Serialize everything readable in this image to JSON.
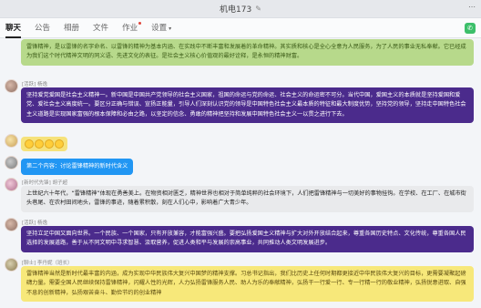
{
  "window": {
    "title": "机电173",
    "edit_icon": "edit-icon"
  },
  "tabs": [
    {
      "label": "聊天",
      "active": true
    },
    {
      "label": "公告"
    },
    {
      "label": "相册"
    },
    {
      "label": "文件"
    },
    {
      "label": "作业",
      "dot": true
    },
    {
      "label": "设置"
    }
  ],
  "messages": [
    {
      "sender": "",
      "text": "雷锋精神，是以雷锋的名字命名、以雷锋的精神为基本内涵、在实践中不断丰富和发展着的革命精神。其实质和核心是全心全意为人民服务，为了人民的事业无私奉献。它已经成为我们这个时代精神文明的同义语、先进文化的表征。是社会主义核心价值观的最好诠释，是永恒的精神财富。",
      "style": "green"
    },
    {
      "sender": "[活跃] 杨逸",
      "text": "坚持爱党爱国是社会主义精神一。新中国是中国共产党领导的社会主义国家，祖国的命运与党的命运、社会主义的命运密不可分。当代中国，爱国主义的本质就是坚持爱国和爱党、爱社会主义高度统一。要区分正确与错误、宣扬正能量，引导人们深刻认识党的领导是中国特色社会主义最本质的特征和最大制度优势，坚持党的领导，坚持走中国特色社会主义道路是实现国家富强的根本保障和必由之路，以坚定的信念、勇敢的精神把坚持和发展中国特色社会主义一以贯之进行下去。",
      "style": "purple"
    },
    {
      "sender": "",
      "emoji_count": 4,
      "style": "yellow"
    },
    {
      "sender": "",
      "text": "第二个内容：讨论雷锋精神的新时代含义",
      "style": "blue"
    },
    {
      "sender": "[新时代先锋] 胡子超",
      "text": "上世纪六十年代，“雷锋精神”体现在勇善美上。在物资相对匮乏，精神世界也相对于简单纯粹的社会环境下，人们把雷锋精神与一切美好的事物挂钩。在学校、在工厂、在城市街头巷尾、在农村田间地头，雷锋的事迹，随着累积散，刻在人们心中，影响着广大青少年。",
      "style": "gray"
    },
    {
      "sender": "[活跃] 杨逸",
      "text": "坚持立足中国又面向世界。一个民族、一个国家，只有开放兼容，才能富强兴盛。要把弘扬爱国主义精神与扩大对外开放结合起来，尊重各国历史特点、文化传统，尊重各国人民选择的发展道路，善于从不同文明中寻求智慧、汲取营养，促进人类和平与发展的崇高事业，共同推动人类文明发展进步。",
      "style": "purple"
    },
    {
      "sender": "[聊士] 李丹妮（班长）",
      "text": "雷锋精神当然是新时代最丰富的内涵，成为实现中华民族伟大复兴中国梦的精神支撑。习总书记指出，我们比历史上任何时期都更接近中华民族伟大复兴的目标，更需要凝聚起磅礴力量。需要全国人民继续保持雷锋精神，闪耀人性的光辉，人力弘扬雷锋服务人民、助人为乐的奉献精神，弘扬干一行爱一行、专一行精一行的敬业精神，弘扬锐意进取、自强不息的创新精神，弘扬艰苦奋斗、勤俭节约的创业精神",
      "style": "yellow"
    }
  ],
  "colors": {
    "green": "#b7d98b",
    "purple": "#4b2b8c",
    "blue": "#2196f3",
    "gray": "#e9eaec",
    "yellow": "#f7e87a"
  }
}
